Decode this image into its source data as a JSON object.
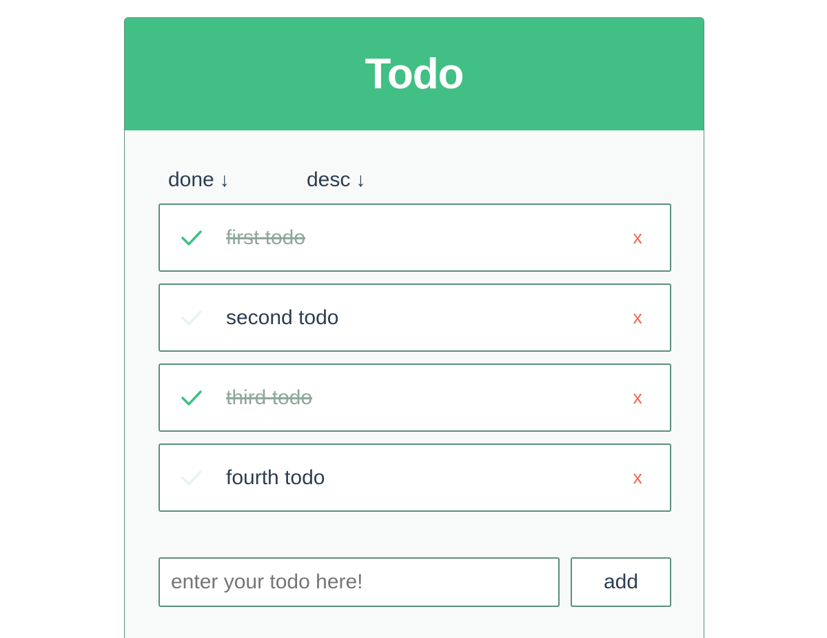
{
  "app": {
    "title": "Todo"
  },
  "colors": {
    "accent": "#42bf84",
    "border": "#5a8f7b",
    "done_text": "#8fa899",
    "remove": "#f2684a",
    "check_done": "#42bf84",
    "check_pending": "#e6f5ee"
  },
  "sort": {
    "done_label": "done",
    "done_arrow": "↓",
    "desc_label": "desc",
    "desc_arrow": "↓"
  },
  "todos": [
    {
      "text": "first todo",
      "done": true,
      "remove_label": "x",
      "icon": "check-icon"
    },
    {
      "text": "second todo",
      "done": false,
      "remove_label": "x",
      "icon": "check-icon"
    },
    {
      "text": "third todo",
      "done": true,
      "remove_label": "x",
      "icon": "check-icon"
    },
    {
      "text": "fourth todo",
      "done": false,
      "remove_label": "x",
      "icon": "check-icon"
    }
  ],
  "add": {
    "placeholder": "enter your todo here!",
    "value": "",
    "button_label": "add"
  }
}
